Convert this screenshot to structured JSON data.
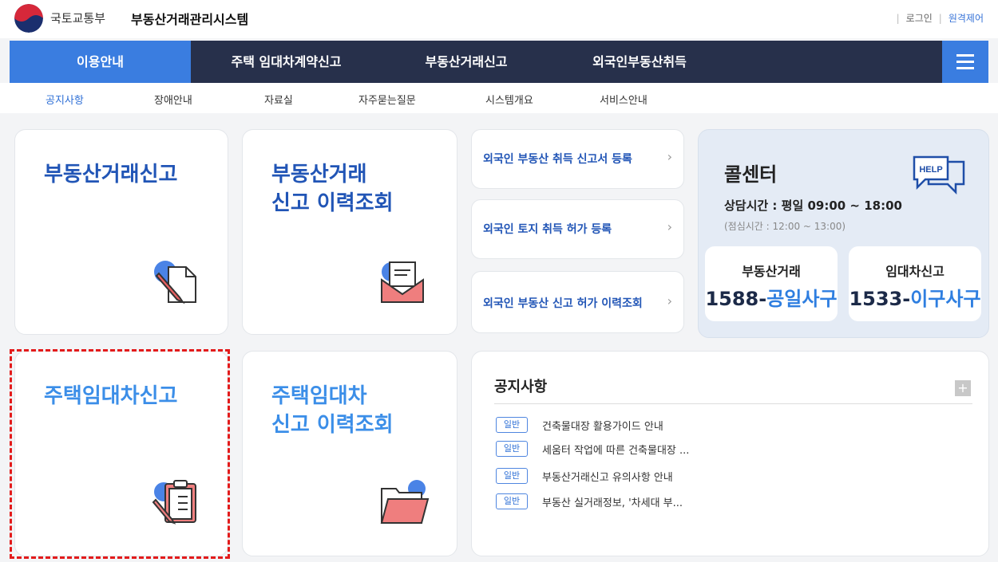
{
  "header": {
    "ministry": "국토교통부",
    "system_name": "부동산거래관리시스템",
    "login": "로그인",
    "remote": "원격제어"
  },
  "nav": {
    "items": [
      "이용안내",
      "주택 임대차계약신고",
      "부동산거래신고",
      "외국인부동산취득"
    ],
    "active_index": 0
  },
  "subnav": {
    "items": [
      "공지사항",
      "장애안내",
      "자료실",
      "자주묻는질문",
      "시스템개요",
      "서비스안내"
    ],
    "active_index": 0
  },
  "cards": {
    "realestate_report": "부동산거래신고",
    "realestate_history": "부동산거래\n신고 이력조회",
    "housing_lease_report": "주택임대차신고",
    "housing_lease_history": "주택임대차\n신고 이력조회"
  },
  "links": [
    {
      "label": "외국인 부동산 취득 신고서 등록"
    },
    {
      "label": "외국인 토지 취득 허가 등록"
    },
    {
      "label": "외국인 부동산 신고 허가 이력조회"
    }
  ],
  "callcenter": {
    "title": "콜센터",
    "help_label": "HELP",
    "hours": "상담시간 : 평일 09:00 ~ 18:00",
    "lunch": "(점심시간 : 12:00 ~ 13:00)",
    "realestate_label": "부동산거래",
    "realestate_prefix": "1588-",
    "realestate_word": "공일사구",
    "lease_label": "임대차신고",
    "lease_prefix": "1533-",
    "lease_word": "이구사구"
  },
  "notice": {
    "title": "공지사항",
    "plus": "+",
    "items": [
      {
        "badge": "일반",
        "text": "건축물대장 활용가이드 안내"
      },
      {
        "badge": "일반",
        "text": "세움터 작업에 따른 건축물대장 ..."
      },
      {
        "badge": "일반",
        "text": "부동산거래신고 유의사항 안내"
      },
      {
        "badge": "일반",
        "text": "부동산 실거래정보, '차세대 부..."
      }
    ]
  },
  "colors": {
    "nav_bg": "#27304b",
    "accent": "#3a7de0",
    "title_blue": "#2155b6",
    "highlight_border": "#e31b1b"
  }
}
